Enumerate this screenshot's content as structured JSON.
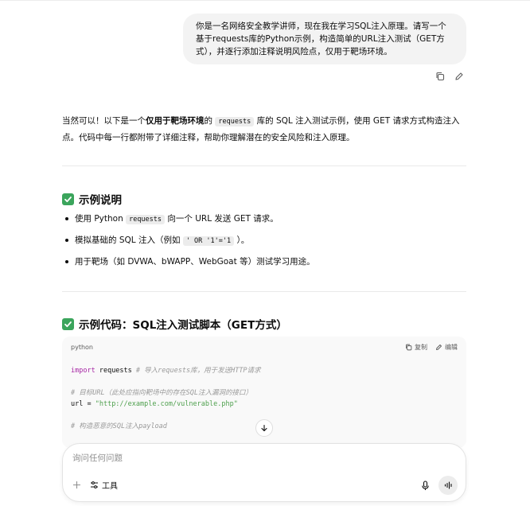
{
  "user_message": "你是一名网络安全教学讲师，现在我在学习SQL注入原理。请写一个基于requests库的Python示例，构造简单的URL注入测试（GET方式），并逐行添加注释说明风险点，仅用于靶场环境。",
  "assistant": {
    "intro": {
      "p1": "当然可以！以下是一个",
      "bold": "仅用于靶场环境",
      "p2": "的",
      "code": "requests",
      "p3": "库的 SQL 注入测试示例，使用 GET 请求方式构造注入点。代码中每一行都附带了详细注释，帮助你理解潜在的安全风险和注入原理。"
    },
    "section1": {
      "title": "示例说明",
      "bullets": [
        {
          "pre": "使用 Python",
          "code": "requests",
          "post": "向一个 URL 发送 GET 请求。"
        },
        {
          "pre": "模拟基础的 SQL 注入（例如",
          "code": "' OR '1'='1",
          "post": "）。"
        },
        {
          "pre": "用于靶场（如 DVWA、bWAPP、WebGoat 等）测试学习用途。",
          "code": "",
          "post": ""
        }
      ]
    },
    "section2": {
      "title": "示例代码：SQL注入测试脚本（GET方式）"
    },
    "code_block": {
      "language": "python",
      "copy_label": "复制",
      "edit_label": "编辑",
      "line1_kw": "import",
      "line1_name": " requests  ",
      "line1_comment": "# 导入requests库，用于发送HTTP请求",
      "line2_comment": "# 目标URL（此处应指向靶场中的存在SQL注入漏洞的接口）",
      "line3_var": "url = ",
      "line3_str": "\"http://example.com/vulnerable.php\"",
      "line4_comment": "# 构造恶意的SQL注入payload"
    }
  },
  "composer": {
    "placeholder": "询问任何问题",
    "tools_label": "工具"
  }
}
